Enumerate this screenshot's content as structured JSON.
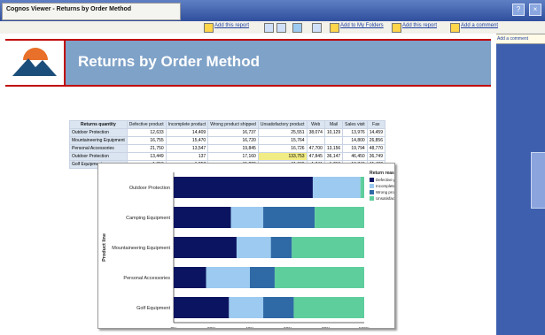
{
  "window": {
    "title": "Cognos Viewer - Returns by Order Method"
  },
  "toolbar": {
    "items": [
      "Add this report",
      "Add to My Folders",
      "Add this report",
      "Add a comment"
    ]
  },
  "popup": {
    "label": "Add a comment"
  },
  "report": {
    "title": "Returns by Order Method"
  },
  "crosstab": {
    "corner": "Returns quantity",
    "columns": [
      "Defective product",
      "Incomplete product",
      "Wrong product shipped",
      "Unsatisfactory product",
      "Web",
      "Mail",
      "Sales visit",
      "Fax"
    ],
    "rows": [
      {
        "label": "Outdoor Protection",
        "values": [
          "12,633",
          "14,409",
          "16,737",
          "25,551",
          "38,074",
          "10,129",
          "13,976",
          "14,459"
        ]
      },
      {
        "label": "Mountaineering Equipment",
        "values": [
          "16,755",
          "15,470",
          "16,720",
          "15,764",
          "",
          "",
          "14,800",
          "26,856"
        ]
      },
      {
        "label": "Personal Accessories",
        "values": [
          "21,750",
          "13,547",
          "19,845",
          "16,726",
          "47,700",
          "13,156",
          "19,794",
          "48,770"
        ]
      },
      {
        "label": "Outdoor Protection",
        "values": [
          "13,449",
          "137",
          "17,160",
          "133,753",
          "47,845",
          "36,147",
          "46,450",
          "36,749"
        ]
      },
      {
        "label": "Golf Equipment",
        "values": [
          "1,718",
          "1,257",
          "11,220",
          "11,630",
          "1,741",
          "1,713",
          "16,746",
          "11,482"
        ]
      }
    ]
  },
  "chart_data": {
    "type": "bar",
    "orientation": "horizontal",
    "stacked": "percent",
    "categories": [
      "Outdoor Protection",
      "Camping Equipment",
      "Mountaineering Equipment",
      "Personal Accessories",
      "Golf Equipment"
    ],
    "series": [
      {
        "name": "Defective product",
        "color": "#0a1460",
        "values": [
          73,
          30,
          33,
          17,
          29
        ]
      },
      {
        "name": "Incomplete product",
        "color": "#9ccaf0",
        "values": [
          25,
          17,
          18,
          23,
          18
        ]
      },
      {
        "name": "Wrong product shipped",
        "color": "#2f6aa6",
        "values": [
          0,
          27,
          11,
          13,
          16
        ]
      },
      {
        "name": "Unsatisfactory product",
        "color": "#5fce9d",
        "values": [
          2,
          26,
          38,
          47,
          37
        ]
      }
    ],
    "xticks": [
      "0%",
      "20%",
      "40%",
      "60%",
      "80%",
      "100%"
    ],
    "xlabel": "Returns quantity",
    "ylabel": "Product line",
    "legend_title": "Return reason",
    "legend_position": "right"
  }
}
